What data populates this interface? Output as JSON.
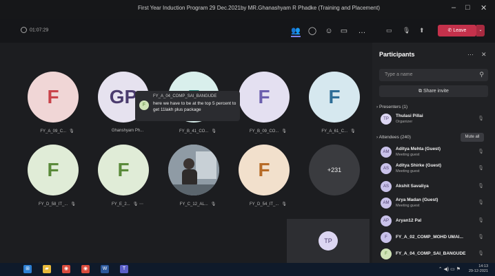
{
  "window": {
    "title": "First Year Induction Program 29 Dec.2021by MR.Ghanashyam R Phadke (Training and Placement)"
  },
  "meeting": {
    "timer": "01:07:29",
    "leave_label": "Leave"
  },
  "chat_popup": {
    "sender": "FY_A_04_COMP_SAI_BANGUDE",
    "initial": "F",
    "message": "here we have to be at the top 5 percent to get 11lakh plus package"
  },
  "tiles": [
    {
      "initial": "F",
      "label": "FY_A_09_C...",
      "color": "red"
    },
    {
      "initial": "GP",
      "label": "Ghanshyam Ph...",
      "color": "gray"
    },
    {
      "initial": "F",
      "label": "FY_B_41_CO...",
      "color": "teal"
    },
    {
      "initial": "F",
      "label": "FY_B_09_CO...",
      "color": "purple"
    },
    {
      "initial": "F",
      "label": "FY_A_61_C...",
      "color": "blue"
    },
    {
      "initial": "F",
      "label": "FY_D_58_IT_...",
      "color": "green"
    },
    {
      "initial": "F",
      "label": "FY_E_2...",
      "color": "green"
    },
    {
      "initial": "",
      "label": "FY_C_12_AL...",
      "color": "photo"
    },
    {
      "initial": "F",
      "label": "FY_D_54_IT_...",
      "color": "orange"
    },
    {
      "initial": "+231",
      "label": "",
      "color": "more"
    }
  ],
  "self_view": {
    "initial": "TP"
  },
  "participants": {
    "title": "Participants",
    "search_placeholder": "Type a name",
    "share_invite": "Share invite",
    "presenters_label": "Presenters (1)",
    "attendees_label": "Attendees (240)",
    "mute_all": "Mute all",
    "presenters": [
      {
        "initials": "TP",
        "name": "Thulasi Pillai",
        "role": "Organizer"
      }
    ],
    "attendees": [
      {
        "initials": "AM",
        "name": "Aditya Mehta (Guest)",
        "role": "Meeting guest"
      },
      {
        "initials": "AS",
        "name": "Aditya Shirke (Guest)",
        "role": "Meeting guest"
      },
      {
        "initials": "AS",
        "name": "Akshit Savaliya",
        "role": ""
      },
      {
        "initials": "AM",
        "name": "Arya Madan (Guest)",
        "role": "Meeting guest"
      },
      {
        "initials": "AP",
        "name": "Aryan12 Pal",
        "role": ""
      },
      {
        "initials": "F",
        "name": "FY_A_02_COMP_MOHD UMAI...",
        "role": ""
      },
      {
        "initials": "F",
        "name": "FY_A_04_COMP_SAI_BANGUDE",
        "role": ""
      }
    ]
  },
  "taskbar": {
    "time": "14:13",
    "date": "29-12-2021"
  }
}
